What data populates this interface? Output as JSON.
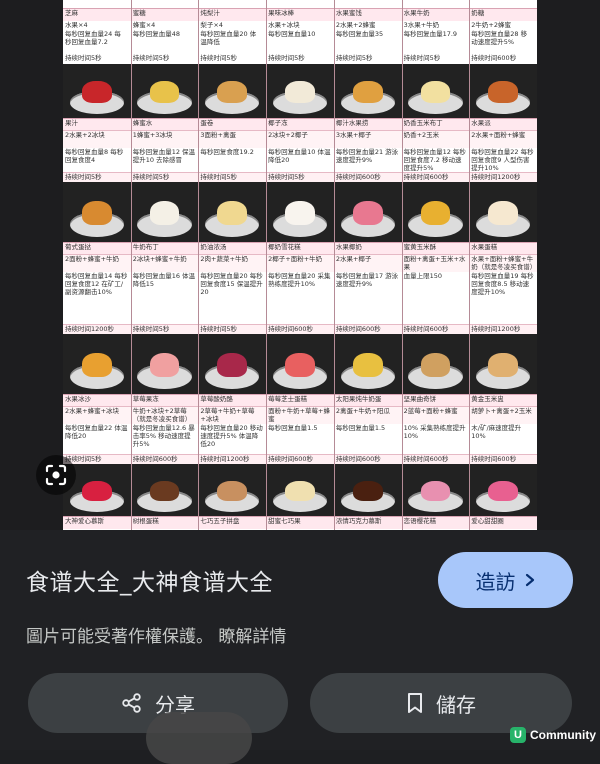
{
  "colors": {
    "accent": "#a8c7fa",
    "sheet_bg": "#202124",
    "button_bg": "#3c4043",
    "watermark_green": "#27b36a"
  },
  "image": {
    "top_row": [
      {
        "name": "芝麻",
        "ing": "水果×4",
        "eff": "每秒回复血量24 每秒回复血量7.2",
        "dur": "持续时间5秒"
      },
      {
        "name": "蜜糖",
        "ing": "蜂蜜×4",
        "eff": "每秒回复血量48",
        "dur": "持续时间5秒"
      },
      {
        "name": "炖梨汁",
        "ing": "梨子×4",
        "eff": "每秒回复血量20 体温降低",
        "dur": "持续时间5秒"
      },
      {
        "name": "果味冰棒",
        "ing": "水果+冰块",
        "eff": "每秒回复血量10",
        "dur": "持续时间5秒"
      },
      {
        "name": "水果蜜饯",
        "ing": "2水果+2蜂蜜",
        "eff": "每秒回复血量35",
        "dur": "持续时间5秒"
      },
      {
        "name": "水果牛奶",
        "ing": "3水果+牛奶",
        "eff": "每秒回复血量17.9",
        "dur": "持续时间5秒"
      },
      {
        "name": "奶糖",
        "ing": "2牛奶+2蜂蜜",
        "eff": "每秒回复血量28 移动速度提升5%",
        "dur": "持续时间600秒"
      }
    ],
    "row1": [
      {
        "name": "果汁",
        "ing": "2水果+2冰块",
        "eff": "每秒回复血量8 每秒回复食度4",
        "dur": "持续时间5秒",
        "c": "#c8262a"
      },
      {
        "name": "蜂蜜水",
        "ing": "1蜂蜜+3冰块",
        "eff": "每秒回复血量12 保温提升10 去除感冒",
        "dur": "持续时间5秒",
        "c": "#e8c24a"
      },
      {
        "name": "蛋卷",
        "ing": "3面粉+禽蛋",
        "eff": "每秒回复食度19.2",
        "dur": "持续时间5秒",
        "c": "#d9a050"
      },
      {
        "name": "椰子冻",
        "ing": "2冰块+2椰子",
        "eff": "每秒回复血量10 体温降低20",
        "dur": "持续时间5秒",
        "c": "#f2ead8"
      },
      {
        "name": "椰汁水果捞",
        "ing": "3水果+椰子",
        "eff": "每秒回复血量21 游泳速度提升9%",
        "dur": "持续时间600秒",
        "c": "#e0a040"
      },
      {
        "name": "奶香玉米布丁",
        "ing": "奶香+2玉米",
        "eff": "每秒回复血量12 每秒回复食度7.2 移动速度提升5%",
        "dur": "持续时间600秒",
        "c": "#f2e0a0"
      },
      {
        "name": "水果派",
        "ing": "2水果+面粉+蜂蜜",
        "eff": "每秒回复血量22 每秒回复食度9 人型伤害提升10%",
        "dur": "持续时间1200秒",
        "c": "#c8642a"
      }
    ],
    "row2": [
      {
        "name": "葡式蛋挞",
        "ing": "2面粉+蜂蜜+牛奶",
        "eff": "每秒回复血量14 每秒回复食度12 在矿工/副资源翻击10%",
        "dur": "持续时间1200秒",
        "c": "#d88a30"
      },
      {
        "name": "牛奶布丁",
        "ing": "2冰块+蜂蜜+牛奶",
        "eff": "每秒回复血量16 体温降低15",
        "dur": "持续时间5秒",
        "c": "#f4f0e6"
      },
      {
        "name": "奶油浓汤",
        "ing": "2肉+蔬菜+牛奶",
        "eff": "每秒回复血量20 每秒回复食度15 保温提升20",
        "dur": "持续时间5秒",
        "c": "#f0d890"
      },
      {
        "name": "椰奶雪花糕",
        "ing": "2椰子+面粉+牛奶",
        "eff": "每秒回复血量20 采集熟练度提升10%",
        "dur": "持续时间600秒",
        "c": "#f8f4ee"
      },
      {
        "name": "水果椰奶",
        "ing": "2水果+椰子",
        "eff": "每秒回复血量17 游泳速度提升9%",
        "dur": "持续时间600秒",
        "c": "#e87890"
      },
      {
        "name": "蜜黄玉米酥",
        "ing": "面粉+禽蛋+玉米+水果",
        "eff": "血量上限150",
        "dur": "持续时间600秒",
        "c": "#e8b030"
      },
      {
        "name": "水果蛋糕",
        "ing": "水果+面粉+蜂蜜+牛奶（就是冬凌买食谱）",
        "eff": "每秒回复血量19 每秒回复食度8.5 移动速度提升10%",
        "dur": "持续时间1200秒",
        "c": "#f6e8d0"
      }
    ],
    "row3": [
      {
        "name": "水果冰沙",
        "ing": "2水果+蜂蜜+冰块",
        "eff": "每秒回复血量22 体温降低20",
        "dur": "持续时间5秒",
        "c": "#e8a030"
      },
      {
        "name": "草莓果冻",
        "ing": "牛奶+冰块+2草莓（就是冬凌买食谱）",
        "eff": "每秒回复血量12.6 暴击率5% 移动速度提升5%",
        "dur": "持续时间600秒",
        "c": "#f0a0a0"
      },
      {
        "name": "草莓酸奶酪",
        "ing": "2草莓+牛奶+草莓+冰块",
        "eff": "每秒回复血量20 移动速度提升5% 体温降低20",
        "dur": "持续时间1200秒",
        "c": "#a8284a"
      },
      {
        "name": "莓莓芝士蛋糕",
        "ing": "面粉+牛奶+草莓+蜂蜜",
        "eff": "每秒回复血量1.5",
        "dur": "持续时间600秒",
        "c": "#e86060"
      },
      {
        "name": "太阳果炖牛奶蛋",
        "ing": "2禽蛋+牛奶+阳瓜",
        "eff": "每秒回复血量1.5",
        "dur": "持续时间600秒",
        "c": "#e8c040"
      },
      {
        "name": "坚果曲奇饼",
        "ing": "2蓝莓+面粉+蜂蜜",
        "eff": "10% 采集熟练度提升10%",
        "dur": "持续时间600秒",
        "c": "#d0a060"
      },
      {
        "name": "黄金玉米盅",
        "ing": "胡萝卜+禽蛋+2玉米",
        "eff": "木/矿/麻速度提升10%",
        "dur": "持续时间600秒",
        "c": "#e0b070"
      }
    ],
    "row4": [
      {
        "name": "大神爱心慕斯",
        "c": "#d82040"
      },
      {
        "name": "树根蛋糕",
        "c": "#6a3a20"
      },
      {
        "name": "七巧五子拼盘",
        "c": "#c89060"
      },
      {
        "name": "甜蜜七巧果",
        "c": "#f0e0b0"
      },
      {
        "name": "浓情巧克力慕斯",
        "c": "#4a2010"
      },
      {
        "name": "恋语樱花糕",
        "c": "#e890b0"
      },
      {
        "name": "爱心甜甜圈",
        "c": "#e86090"
      }
    ]
  },
  "sheet": {
    "title": "食谱大全_大神食谱大全",
    "visit_label": "造訪",
    "copyright_text": "圖片可能受著作權保護。",
    "learn_more": "瞭解詳情",
    "share_label": "分享",
    "save_label": "儲存"
  },
  "watermark": {
    "badge": "U",
    "text": "Community"
  }
}
